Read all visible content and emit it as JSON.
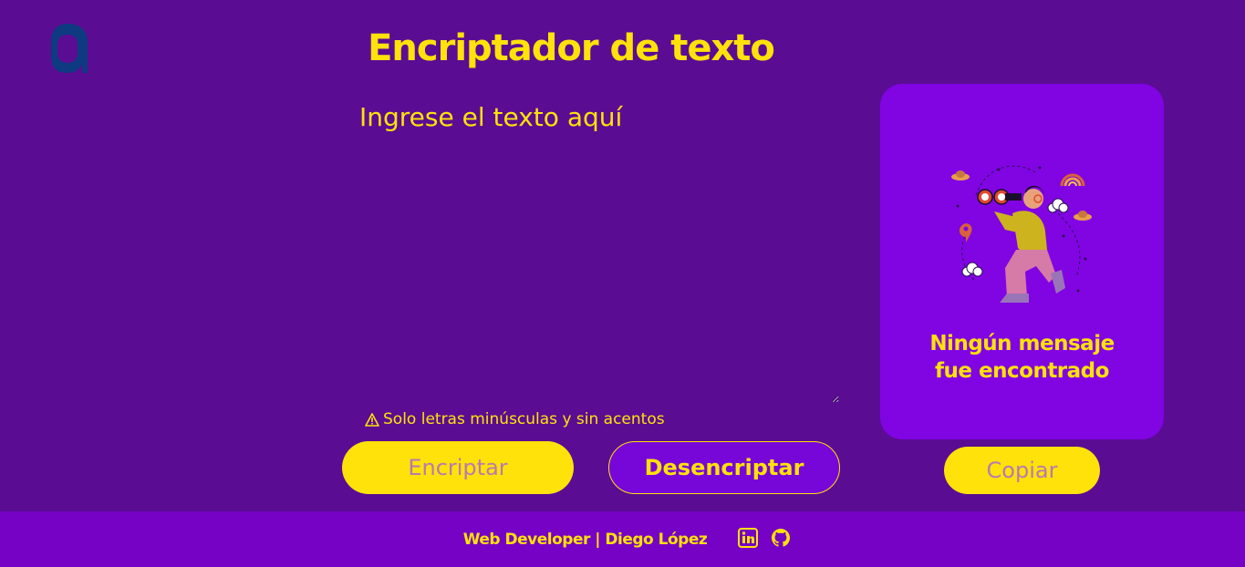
{
  "header": {
    "title": "Encriptador de texto"
  },
  "editor": {
    "placeholder": "Ingrese el texto aquí",
    "warning": "Solo letras minúsculas y sin acentos"
  },
  "actions": {
    "encrypt_label": "Encriptar",
    "decrypt_label": "Desencriptar"
  },
  "output": {
    "empty_line1": "Ningún mensaje",
    "empty_line2": "fue encontrado",
    "copy_label": "Copiar"
  },
  "footer": {
    "credit": "Web Developer | Diego López",
    "icons": [
      "linkedin-icon",
      "github-icon"
    ]
  },
  "colors": {
    "background": "#5a0c93",
    "accent_yellow": "#ffe20a",
    "panel_purple": "#8104e3",
    "footer_purple": "#7602c5",
    "logo_blue": "#0d3a80"
  }
}
